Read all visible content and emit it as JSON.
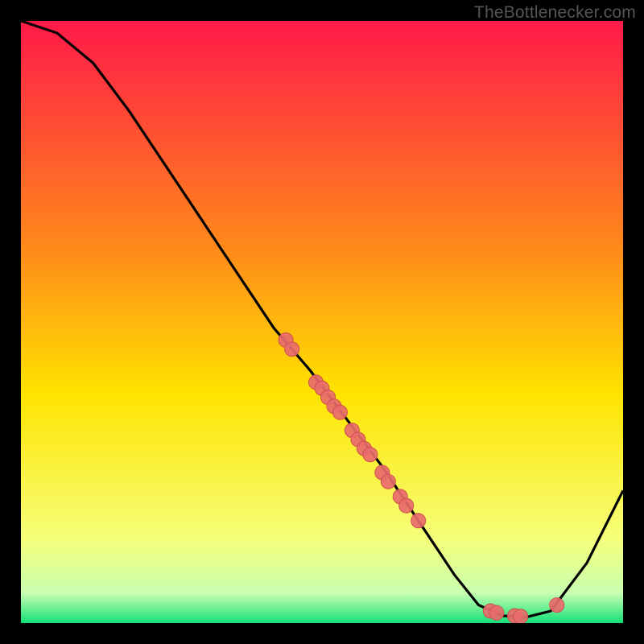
{
  "attribution": "TheBottlenecker.com",
  "colors": {
    "grad_top": "#ff1a49",
    "grad_mid1": "#ff7a1f",
    "grad_mid2": "#ffe400",
    "grad_mid3": "#f4ff6e",
    "grad_bot": "#14e07a",
    "curve": "#000000",
    "marker_fill": "#e86b6b",
    "marker_stroke": "#d04e4e"
  },
  "chart_data": {
    "type": "line",
    "xlabel": "",
    "ylabel": "",
    "xlim": [
      0,
      100
    ],
    "ylim": [
      0,
      100
    ],
    "title": "",
    "curve": [
      {
        "x": 0,
        "y": 100
      },
      {
        "x": 6,
        "y": 98
      },
      {
        "x": 12,
        "y": 93
      },
      {
        "x": 18,
        "y": 85
      },
      {
        "x": 24,
        "y": 76
      },
      {
        "x": 30,
        "y": 67
      },
      {
        "x": 36,
        "y": 58
      },
      {
        "x": 42,
        "y": 49
      },
      {
        "x": 48,
        "y": 42
      },
      {
        "x": 54,
        "y": 34
      },
      {
        "x": 60,
        "y": 26
      },
      {
        "x": 66,
        "y": 17
      },
      {
        "x": 72,
        "y": 8
      },
      {
        "x": 76,
        "y": 3
      },
      {
        "x": 80,
        "y": 1.2
      },
      {
        "x": 84,
        "y": 1.0
      },
      {
        "x": 88,
        "y": 2
      },
      {
        "x": 94,
        "y": 10
      },
      {
        "x": 100,
        "y": 22
      }
    ],
    "markers": [
      {
        "x": 44,
        "y": 47
      },
      {
        "x": 45,
        "y": 45.5
      },
      {
        "x": 49,
        "y": 40
      },
      {
        "x": 50,
        "y": 39
      },
      {
        "x": 51,
        "y": 37.5
      },
      {
        "x": 52,
        "y": 36
      },
      {
        "x": 53,
        "y": 35
      },
      {
        "x": 55,
        "y": 32
      },
      {
        "x": 56,
        "y": 30.5
      },
      {
        "x": 57,
        "y": 29
      },
      {
        "x": 58,
        "y": 28
      },
      {
        "x": 60,
        "y": 25
      },
      {
        "x": 61,
        "y": 23.5
      },
      {
        "x": 63,
        "y": 21
      },
      {
        "x": 64,
        "y": 19.5
      },
      {
        "x": 66,
        "y": 17
      },
      {
        "x": 78,
        "y": 2
      },
      {
        "x": 79,
        "y": 1.7
      },
      {
        "x": 82,
        "y": 1.2
      },
      {
        "x": 83,
        "y": 1.1
      },
      {
        "x": 89,
        "y": 3
      }
    ]
  }
}
